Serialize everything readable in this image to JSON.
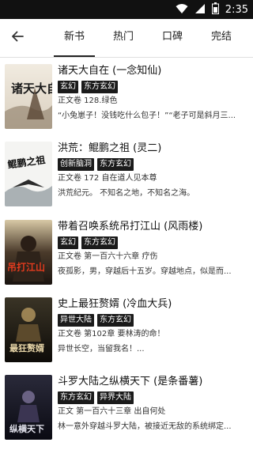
{
  "status_bar": {
    "time": "2:35"
  },
  "nav": {
    "tabs": [
      {
        "label": "新书"
      },
      {
        "label": "热门"
      },
      {
        "label": "口碑"
      },
      {
        "label": "完结"
      }
    ]
  },
  "books": [
    {
      "title": "诸天大自在 (一念知仙)",
      "tags": [
        "玄幻",
        "东方玄幻"
      ],
      "chapter": "正文卷 128.绿色",
      "desc": "“小兔崽子！没钱吃什么包子！”“老子可是斜月三...",
      "cover_title": "诸天大自在"
    },
    {
      "title": "洪荒：鲲鹏之祖 (灵二)",
      "tags": [
        "创新脑洞",
        "东方玄幻"
      ],
      "chapter": "正文卷 172 自在道人见本尊",
      "desc": "洪荒纪元。        不知名之地，不知名之海。",
      "cover_title": "鲲鹏之祖"
    },
    {
      "title": "带着召唤系统吊打江山 (风雨楼)",
      "tags": [
        "玄幻",
        "东方玄幻"
      ],
      "chapter": "正文卷 第一百六十六章 疗伤",
      "desc": "夜孤影，男，穿越后十五岁。穿越地点，似是而...",
      "cover_title": "吊打江山"
    },
    {
      "title": "史上最狂赘婿 (冷血大兵)",
      "tags": [
        "异世大陆",
        "东方玄幻"
      ],
      "chapter": "正文卷 第102章 要林涛的命！",
      "desc": "异世长空，当留我名！...",
      "cover_title": "最狂赘婿"
    },
    {
      "title": "斗罗大陆之纵横天下 (是条番薯)",
      "tags": [
        "东方玄幻",
        "异界大陆"
      ],
      "chapter": "正文 第一百六十三章 出自何处",
      "desc": "林一意外穿越斗罗大陆，被接近无敌的系统绑定...",
      "cover_title": "纵横天下"
    }
  ]
}
